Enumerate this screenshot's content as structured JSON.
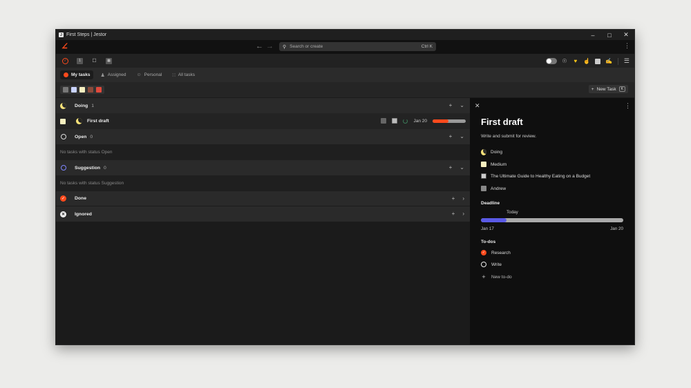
{
  "window": {
    "title": "First Steps | Jestor"
  },
  "topbar": {
    "search_placeholder": "Search or create",
    "search_shortcut": "Ctrl K"
  },
  "tabs": [
    {
      "label": "My tasks"
    },
    {
      "label": "Assigned"
    },
    {
      "label": "Personal"
    },
    {
      "label": "All tasks"
    }
  ],
  "filters": {
    "new_task_label": "New Task",
    "new_task_shortcut": "K"
  },
  "groups": {
    "doing": {
      "name": "Doing",
      "count": "1"
    },
    "open": {
      "name": "Open",
      "count": "0",
      "empty": "No tasks with status Open"
    },
    "suggestion": {
      "name": "Suggestion",
      "count": "0",
      "empty": "No tasks with status Suggestion"
    },
    "done": {
      "name": "Done"
    },
    "ignored": {
      "name": "Ignored"
    }
  },
  "task": {
    "name": "First draft",
    "date": "Jan 20",
    "progress": 0.48
  },
  "detail": {
    "title": "First draft",
    "description": "Write and submit for review.",
    "status": "Doing",
    "priority": "Medium",
    "document": "The Ultimate Guide to Healthy Eating on a Budget",
    "assignee": "Andrew",
    "deadline_label": "Deadline",
    "today_label": "Today",
    "start_date": "Jan 17",
    "end_date": "Jan 20",
    "deadline_progress": 0.18,
    "todos_label": "To-dos",
    "todos": [
      {
        "label": "Research",
        "done": true
      },
      {
        "label": "Write",
        "done": false
      }
    ],
    "new_todo_label": "New to-do"
  },
  "colors": {
    "accent": "#ff4a1c",
    "timeline": "#5a5ae6",
    "filter_swatches": [
      "#777777",
      "#c9d3ff",
      "#f7f0c0",
      "#8a4a3a",
      "#e0493c"
    ]
  }
}
